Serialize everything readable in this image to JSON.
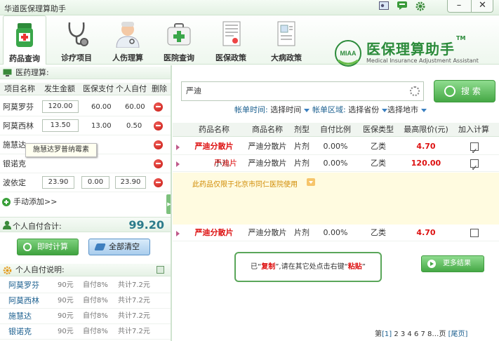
{
  "app": {
    "title": "华道医保理算助手"
  },
  "toolbar": {
    "tabs": [
      {
        "label": "药品查询",
        "icon": "medicine-bottle-icon"
      },
      {
        "label": "诊疗项目",
        "icon": "stethoscope-icon"
      },
      {
        "label": "人伤理算",
        "icon": "doctor-icon"
      },
      {
        "label": "医院查询",
        "icon": "first-aid-kit-icon"
      },
      {
        "label": "医保政策",
        "icon": "policy-document-icon"
      },
      {
        "label": "大病政策",
        "icon": "medical-record-icon"
      }
    ],
    "active_tab": 0
  },
  "logo": {
    "badge": "MIAA",
    "title": "医保理算助手",
    "subtitle": "Medical Insurance Adjustment Assistant",
    "tm": "TM"
  },
  "calc": {
    "header": "医药理算:",
    "columns": [
      "项目名称",
      "发生金额",
      "医保支付",
      "个人自付",
      "删除"
    ],
    "rows": [
      {
        "name": "阿莫罗芬",
        "amount": "120.00",
        "insurance": "60.00",
        "self": "60.00"
      },
      {
        "name": "阿莫西林",
        "amount": "13.50",
        "insurance": "13.00",
        "self": "0.50"
      },
      {
        "name": "施慧达",
        "amount": "",
        "insurance": "",
        "self": ""
      },
      {
        "name": "银诺克",
        "amount": "",
        "insurance": "",
        "self": ""
      },
      {
        "name": "波依定",
        "amount": "23.90",
        "insurance": "0.00",
        "self": "23.90"
      }
    ],
    "tooltip": "施慧达罗普纳霉素",
    "add_label": "手动添加>>",
    "total_label": "个人自付合计:",
    "total_value": "99.20",
    "calc_button": "即时计算",
    "clear_button": "全部清空"
  },
  "desc": {
    "header": "个人自付说明:",
    "rows": [
      {
        "name": "阿莫罗芬",
        "price": "90元",
        "pct": "自付8%",
        "sum": "共计7.2元"
      },
      {
        "name": "阿莫西林",
        "price": "90元",
        "pct": "自付8%",
        "sum": "共计7.2元"
      },
      {
        "name": "施慧达",
        "price": "90元",
        "pct": "自付8%",
        "sum": "共计7.2元"
      },
      {
        "name": "银诺克",
        "price": "90元",
        "pct": "自付8%",
        "sum": "共计7.2元"
      }
    ]
  },
  "search": {
    "query": "严迪",
    "button": "搜 索",
    "filters": [
      {
        "key": "帐单时间:",
        "value": "选择时间"
      },
      {
        "key": "帐单区域:",
        "value": "选择省份"
      },
      {
        "key": "",
        "value": "选择地市"
      }
    ]
  },
  "results": {
    "columns": [
      "药品名称",
      "商品名称",
      "剂型",
      "自付比例",
      "医保类型",
      "最高限价(元)",
      "加入计算"
    ],
    "rows": [
      {
        "prefix": "",
        "name": "严迪分散片",
        "trade": "严迪分散片",
        "form": "片剂",
        "ratio": "0.00%",
        "type": "乙类",
        "price": "4.70",
        "checked": "✓"
      },
      {
        "prefix": "小儿",
        "name": "严迪片",
        "trade": "严迪分散片",
        "form": "片剂",
        "ratio": "0.00%",
        "type": "乙类",
        "price": "120.00",
        "checked": "✓"
      },
      {
        "prefix": "",
        "name": "严迪分散片",
        "trade": "严迪分散片",
        "form": "片剂",
        "ratio": "0.00%",
        "type": "乙类",
        "price": "4.70",
        "checked": ""
      }
    ],
    "notice": "此药品仅限于北京市同仁医院使用",
    "copied": {
      "before": "已“",
      "word1": "复制",
      "middle": "”,请在其它处点击右键“",
      "word2": "粘贴",
      "after": "”"
    },
    "more_button": "更多结果",
    "pager": {
      "prefix": "第",
      "current": "[1]",
      "pages": " 2 3 4 6 7 8…页  ",
      "last": "[尾页]"
    }
  },
  "colors": {
    "brand_green": "#2c8b3b",
    "price_red": "#dd1111",
    "link_blue": "#1b5f8f"
  }
}
